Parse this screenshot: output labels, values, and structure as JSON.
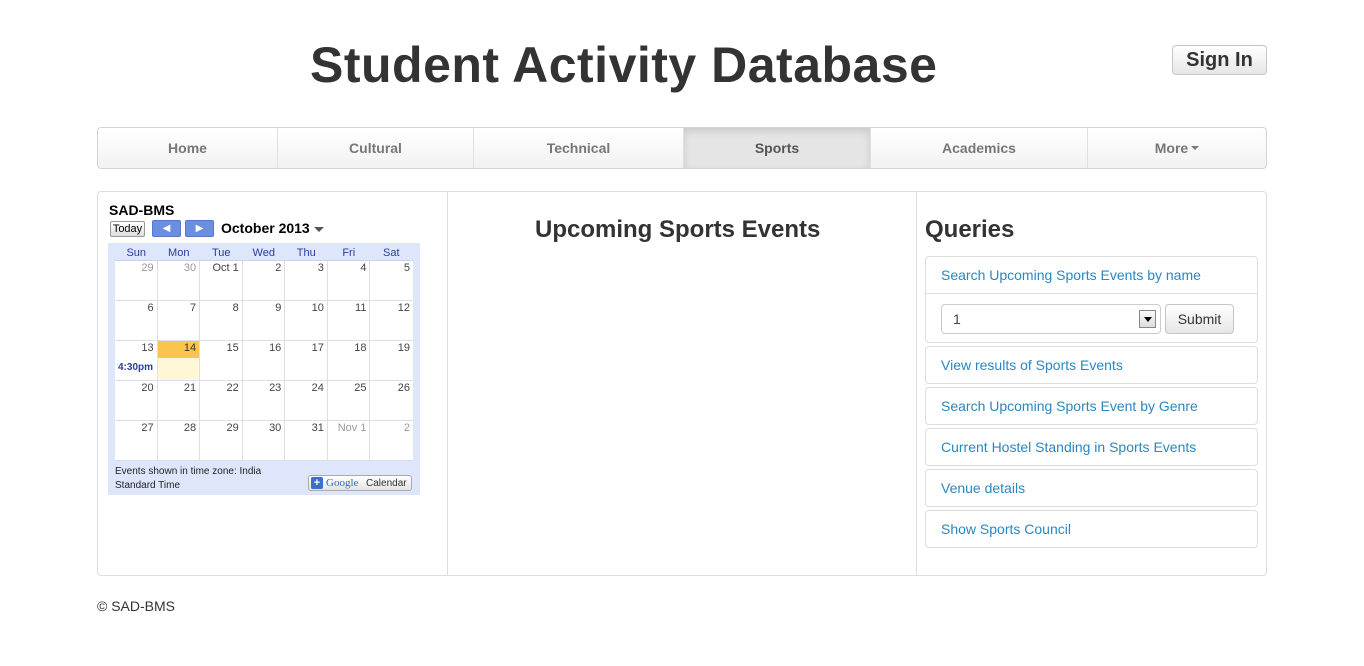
{
  "header": {
    "title": "Student Activity Database",
    "sign_in": "Sign In"
  },
  "nav": {
    "items": [
      {
        "label": "Home"
      },
      {
        "label": "Cultural"
      },
      {
        "label": "Technical"
      },
      {
        "label": "Sports",
        "active": true
      },
      {
        "label": "Academics"
      },
      {
        "label": "More"
      }
    ]
  },
  "calendar": {
    "title": "SAD-BMS",
    "today_label": "Today",
    "month": "October 2013",
    "weekdays": [
      "Sun",
      "Mon",
      "Tue",
      "Wed",
      "Thu",
      "Fri",
      "Sat"
    ],
    "weeks": [
      [
        "29",
        "30",
        "Oct 1",
        "2",
        "3",
        "4",
        "5"
      ],
      [
        "6",
        "7",
        "8",
        "9",
        "10",
        "11",
        "12"
      ],
      [
        "13",
        "14",
        "15",
        "16",
        "17",
        "18",
        "19"
      ],
      [
        "20",
        "21",
        "22",
        "23",
        "24",
        "25",
        "26"
      ],
      [
        "27",
        "28",
        "29",
        "30",
        "31",
        "Nov 1",
        "2"
      ]
    ],
    "today": "14",
    "event_time": "4:30pm",
    "timezone_note": "Events shown in time zone: India Standard Time",
    "gcal_brand": "Google",
    "gcal_label": "Calendar"
  },
  "main": {
    "heading": "Upcoming Sports Events"
  },
  "queries": {
    "title": "Queries",
    "search_by_name": "Search Upcoming Sports Events by name",
    "select_value": "1",
    "submit_label": "Submit",
    "links": [
      "View results of Sports Events",
      "Search Upcoming Sports Event by Genre",
      "Current Hostel Standing in Sports Events",
      "Venue details",
      "Show Sports Council"
    ]
  },
  "footer": {
    "text": "© SAD-BMS"
  },
  "colors": {
    "link": "#2a87c2",
    "today_highlight": "#f9c54c",
    "calendar_bg": "#dde6fb"
  }
}
